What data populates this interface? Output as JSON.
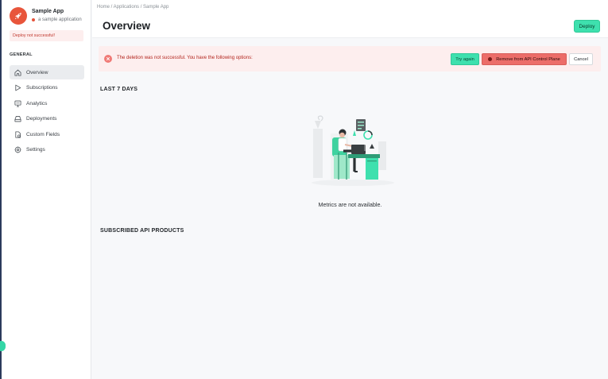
{
  "app": {
    "name": "Sample App",
    "description": "a sample application",
    "status_color": "#e5533a",
    "deploy_alert": "Deploy not successful!"
  },
  "sidebar": {
    "section_label": "GENERAL",
    "items": [
      {
        "label": "Overview",
        "icon": "home-icon",
        "active": true
      },
      {
        "label": "Subscriptions",
        "icon": "play-icon",
        "active": false
      },
      {
        "label": "Analytics",
        "icon": "monitor-icon",
        "active": false
      },
      {
        "label": "Deployments",
        "icon": "drive-icon",
        "active": false
      },
      {
        "label": "Custom Fields",
        "icon": "document-icon",
        "active": false
      },
      {
        "label": "Settings",
        "icon": "gear-icon",
        "active": false
      }
    ]
  },
  "header": {
    "breadcrumb": "Home / Applications / Sample App",
    "title": "Overview",
    "deploy_label": "Deploy"
  },
  "error_banner": {
    "message": "The deletion was not successful. You have the following options:",
    "try_again_label": "Try again",
    "remove_label": "Remove from API Control Plane",
    "cancel_label": "Cancel"
  },
  "sections": {
    "last_7_days": "LAST 7 DAYS",
    "metrics_message": "Metrics are not available.",
    "subscribed_products": "SUBSCRIBED API PRODUCTS"
  },
  "colors": {
    "accent": "#3ee0ae",
    "danger": "#ec6d69",
    "error_bg": "#fdeeee",
    "logo": "#e8553b"
  }
}
